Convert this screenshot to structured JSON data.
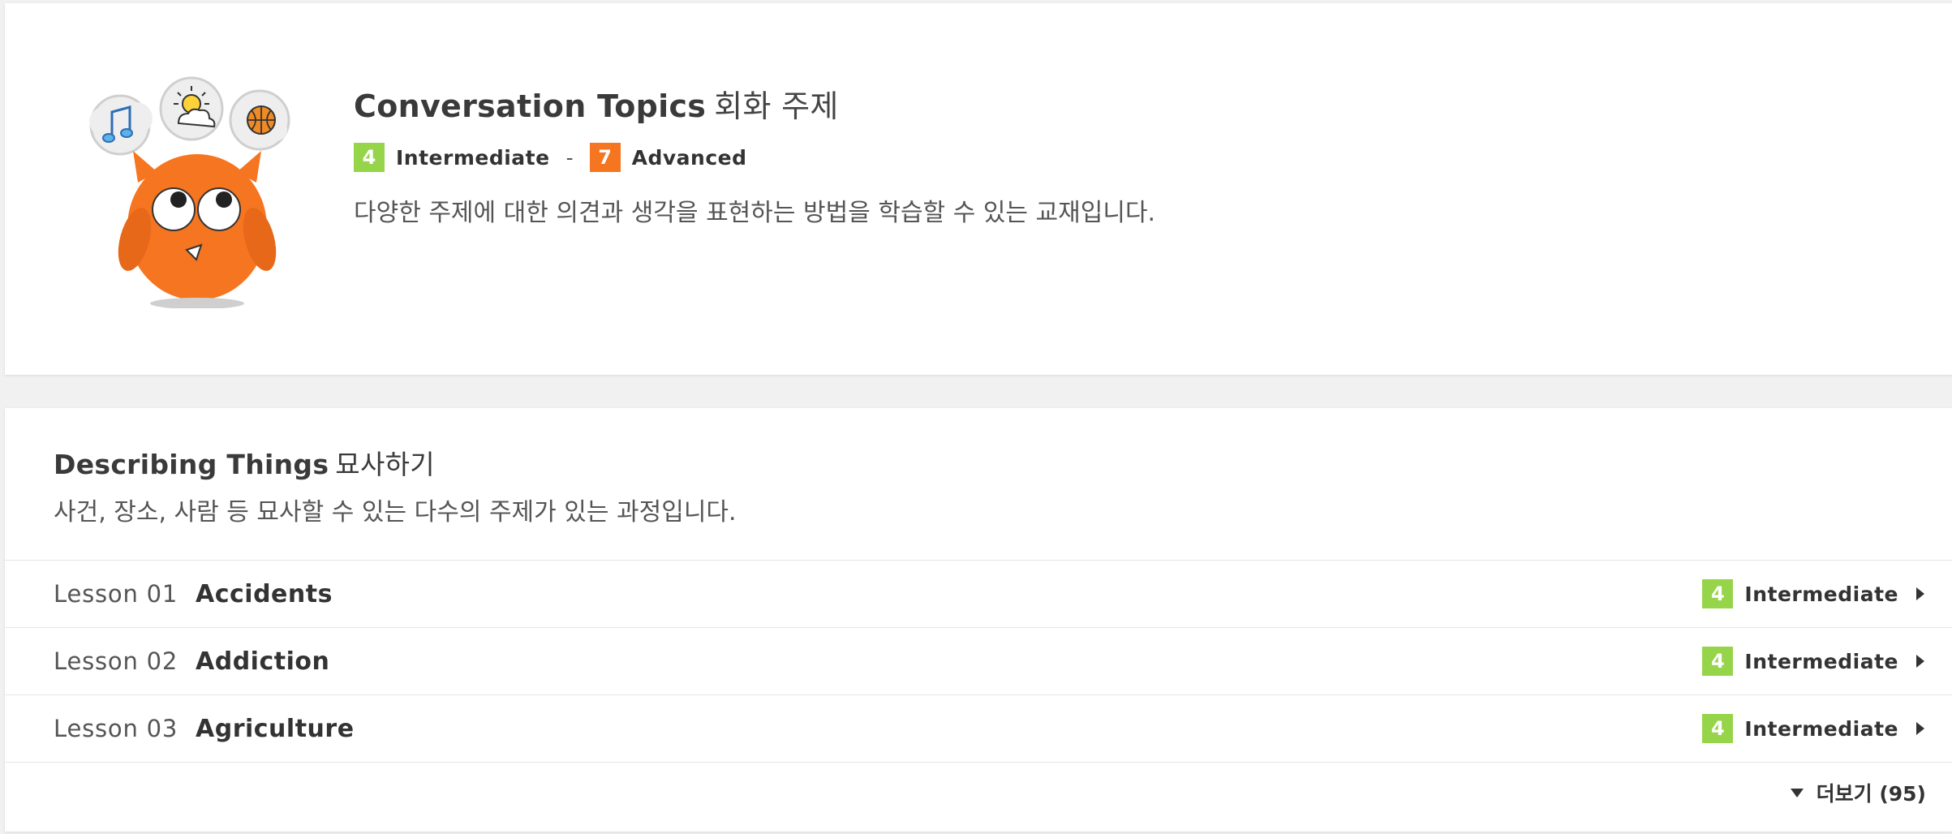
{
  "course": {
    "title_en": "Conversation Topics",
    "title_kr": "회화 주제",
    "level_from": {
      "num": "4",
      "label": "Intermediate",
      "color": "#96d44a"
    },
    "level_separator": "-",
    "level_to": {
      "num": "7",
      "label": "Advanced",
      "color": "#f57520"
    },
    "description": "다양한 주제에 대한 의견과 생각을 표현하는 방법을 학습할 수 있는 교재입니다.",
    "illustration": [
      "music-note-icon",
      "sun-cloud-icon",
      "basketball-icon",
      "owl-mascot"
    ]
  },
  "section": {
    "title_en": "Describing Things",
    "title_kr": "묘사하기",
    "description": "사건, 장소, 사람 등 묘사할 수 있는 다수의 주제가 있는 과정입니다."
  },
  "lessons": [
    {
      "number": "Lesson 01",
      "name": "Accidents",
      "level_num": "4",
      "level_label": "Intermediate"
    },
    {
      "number": "Lesson 02",
      "name": "Addiction",
      "level_num": "4",
      "level_label": "Intermediate"
    },
    {
      "number": "Lesson 03",
      "name": "Agriculture",
      "level_num": "4",
      "level_label": "Intermediate"
    }
  ],
  "more": {
    "label": "더보기 (95)",
    "icon": "caret-down-icon"
  },
  "colors": {
    "background": "#f1f1f1",
    "intermediate": "#96d44a",
    "advanced": "#f57520",
    "owl": "#f57520"
  }
}
